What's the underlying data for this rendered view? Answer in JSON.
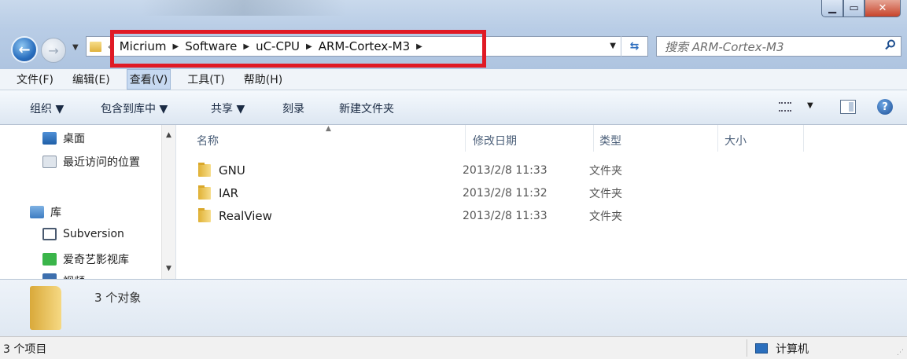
{
  "address": {
    "crumbs": [
      "Micrium",
      "Software",
      "uC-CPU",
      "ARM-Cortex-M3"
    ],
    "overflow_chevron": "«"
  },
  "search": {
    "placeholder": "搜索 ARM-Cortex-M3"
  },
  "menu": [
    "文件(F)",
    "编辑(E)",
    "查看(V)",
    "工具(T)",
    "帮助(H)"
  ],
  "menu_active": "查看(V)",
  "toolbar": {
    "organize": "组织 ▼",
    "include_library": "包含到库中 ▼",
    "share": "共享 ▼",
    "burn": "刻录",
    "new_folder": "新建文件夹"
  },
  "nav": {
    "items": [
      {
        "label": "桌面",
        "icon": "desktop-icon"
      },
      {
        "label": "最近访问的位置",
        "icon": "recent-places-icon"
      },
      {
        "label": "库",
        "icon": "library-icon"
      },
      {
        "label": "Subversion",
        "icon": "subversion-icon"
      },
      {
        "label": "爱奇艺影视库",
        "icon": "iqiyi-icon"
      },
      {
        "label": "视频",
        "icon": "video-icon"
      }
    ]
  },
  "columns": {
    "name": "名称",
    "modified": "修改日期",
    "type": "类型",
    "size": "大小"
  },
  "files": [
    {
      "name": "GNU",
      "modified": "2013/2/8 11:33",
      "type": "文件夹"
    },
    {
      "name": "IAR",
      "modified": "2013/2/8 11:32",
      "type": "文件夹"
    },
    {
      "name": "RealView",
      "modified": "2013/2/8 11:33",
      "type": "文件夹"
    }
  ],
  "details": {
    "count": "3 个对象"
  },
  "status": {
    "items": "3 个项目",
    "location": "计算机"
  },
  "colors": {
    "highlight": "#e01a25",
    "folder": "#f0c550"
  }
}
